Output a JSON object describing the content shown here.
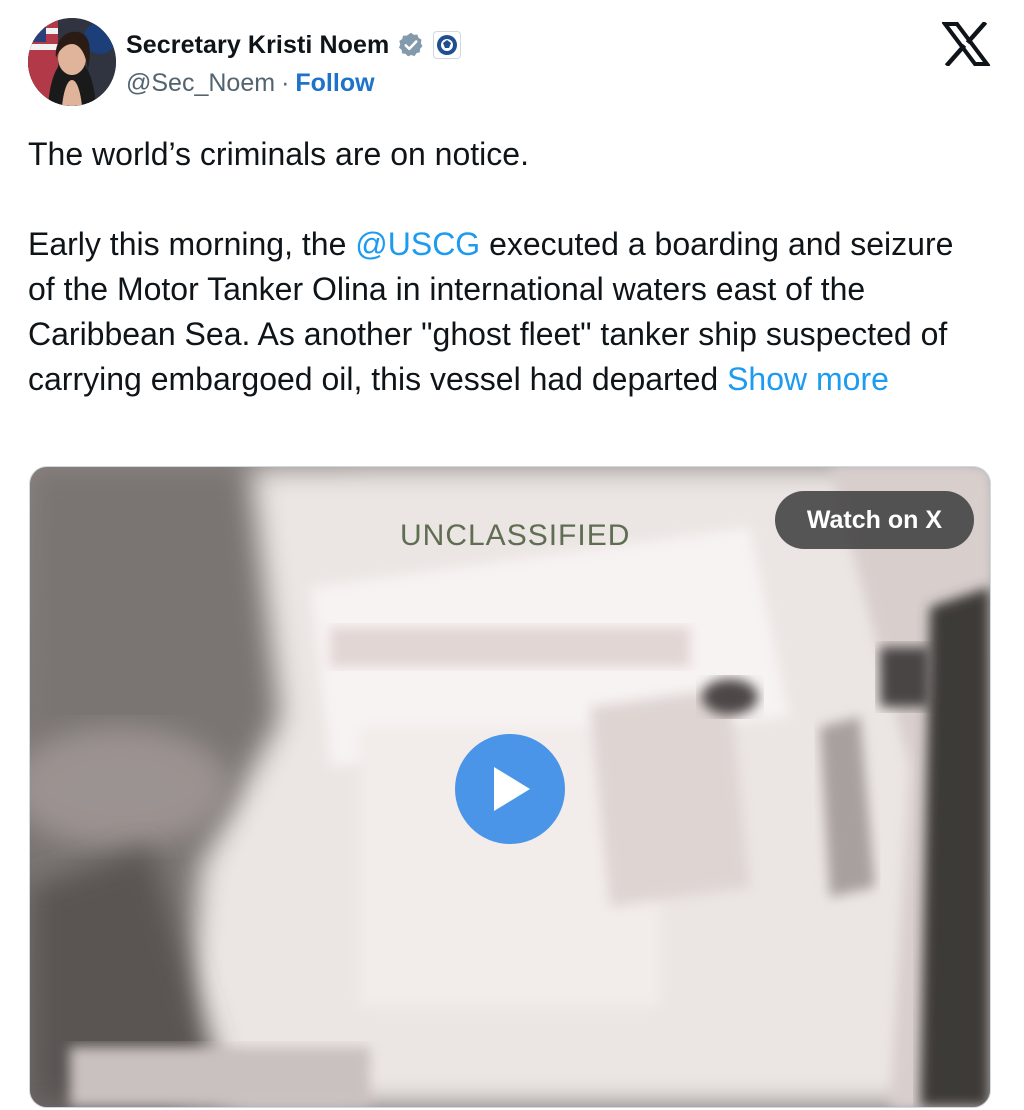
{
  "author": {
    "name": "Secretary Kristi Noem",
    "handle": "@Sec_Noem",
    "separator": "·",
    "follow_label": "Follow"
  },
  "icons": {
    "avatar": "profile-photo",
    "verified": "verified-badge-icon",
    "affiliation": "dhs-seal-icon",
    "logo": "x-logo-icon",
    "play": "play-icon"
  },
  "tweet": {
    "line1": "The world’s criminals are on notice.",
    "para2_before": "Early this morning, the ",
    "mention": "@USCG",
    "para2_after": " executed a boarding and seizure of the Motor Tanker Olina in international waters east of the Caribbean Sea. As another \"ghost fleet\" tanker ship suspected of carrying embargoed oil, this vessel had departed ",
    "show_more": "Show more"
  },
  "media": {
    "overlay_text": "UNCLASSIFIED",
    "watch_label": "Watch on X"
  },
  "colors": {
    "link": "#1d9bf0",
    "follow": "#1d72c9",
    "play_button": "#4a95e8"
  }
}
